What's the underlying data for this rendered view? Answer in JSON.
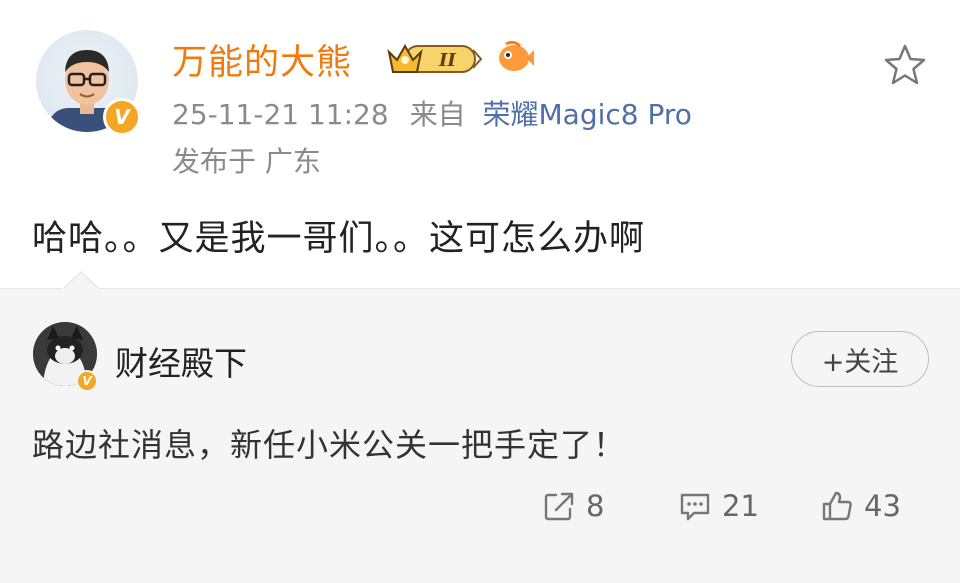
{
  "post": {
    "username": "万能的大熊",
    "level_badge": "II",
    "timestamp": "25-11-21 11:28",
    "from_label": "来自",
    "source": "荣耀Magic8 Pro",
    "location": "发布于 广东",
    "content": "哈哈。。又是我一哥们。。这可怎么办啊"
  },
  "repost": {
    "username": "财经殿下",
    "follow_label": "+关注",
    "content": "路边社消息，新任小米公关一把手定了！"
  },
  "actions": {
    "repost_count": "8",
    "comment_count": "21",
    "like_count": "43"
  },
  "icons": {
    "star": "star-outline-icon",
    "repost": "share-icon",
    "comment": "comment-icon",
    "like": "thumbs-up-icon"
  },
  "colors": {
    "username": "#f27a0c",
    "source_link": "#4f6fa6",
    "meta_gray": "#8a8a8a",
    "verified_badge": "#f5a623",
    "repost_bg": "#f5f5f5"
  }
}
